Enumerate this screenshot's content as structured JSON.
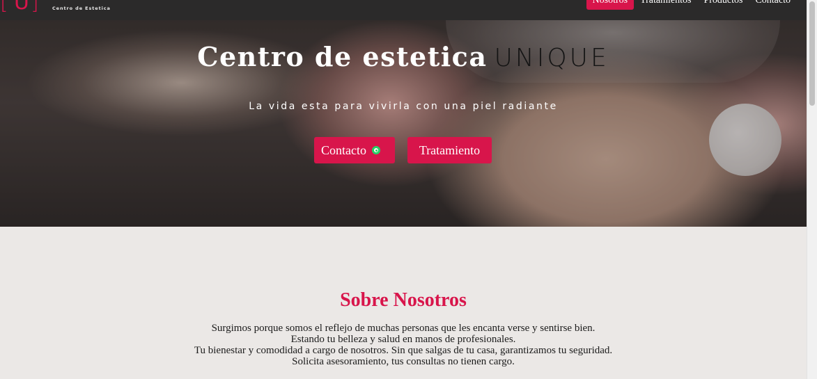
{
  "nav": {
    "logo_letter": "U",
    "logo_subtitle": "Centro de Estetica",
    "items": [
      {
        "label": "Nosotros",
        "active": true
      },
      {
        "label": "Tratamientos",
        "active": false
      },
      {
        "label": "Productos",
        "active": false
      },
      {
        "label": "Contacto",
        "active": false
      }
    ]
  },
  "hero": {
    "title_main": "Centro de estetica",
    "title_brand": "UNIQUE",
    "subtitle": "La vida esta para vivirla con una piel radiante",
    "buttons": {
      "contact_label": "Contacto",
      "treatment_label": "Tratamiento"
    }
  },
  "about": {
    "title": "Sobre Nosotros",
    "lines": [
      "Surgimos porque somos el reflejo de muchas personas que les encanta verse y sentirse bien.",
      "Estando tu belleza y salud en manos de profesionales.",
      "Tu bienestar y comodidad a cargo de nosotros. Sin que salgas de tu casa, garantizamos tu seguridad.",
      "Solicita asesoramiento, tus consultas no tienen cargo."
    ]
  },
  "colors": {
    "accent": "#d8154b",
    "nav_bg": "#2b2a2a",
    "page_bg": "#ebe8e6",
    "whatsapp": "#25d366"
  },
  "icons": {
    "contact_button_icon": "whatsapp-icon"
  }
}
